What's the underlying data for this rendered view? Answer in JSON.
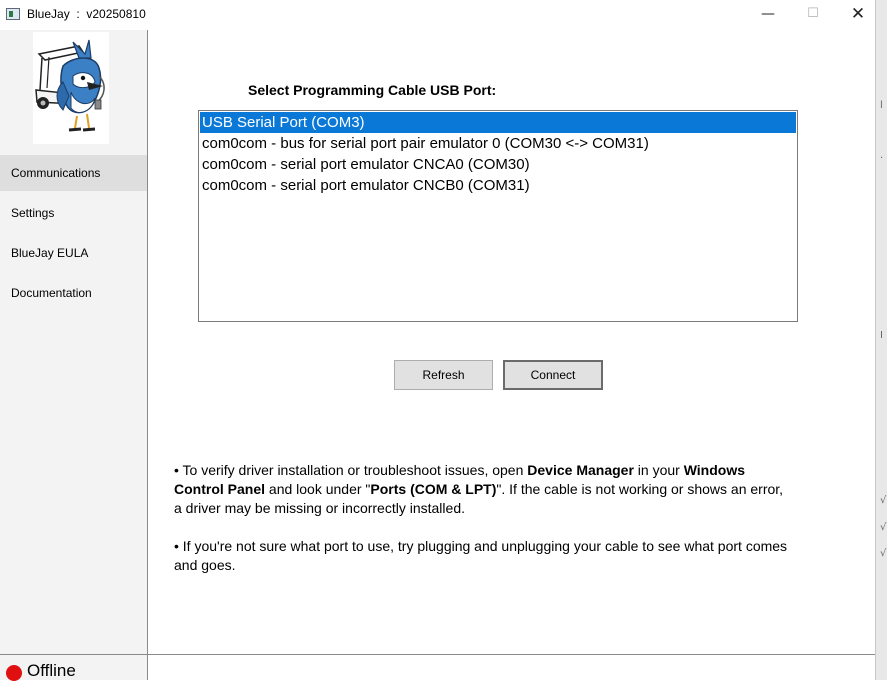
{
  "window": {
    "title": "BlueJay  :  v20250810",
    "minimize_glyph": "—",
    "maximize_glyph": "☐",
    "close_glyph": "✕",
    "app_icon": "app-window-icon"
  },
  "sidebar": {
    "logo": "bluejay-golf-cart-mascot",
    "items": [
      {
        "label": "Communications",
        "active": true
      },
      {
        "label": "Settings",
        "active": false
      },
      {
        "label": "BlueJay EULA",
        "active": false
      },
      {
        "label": "Documentation",
        "active": false
      }
    ],
    "status": {
      "label": "Offline",
      "color": "#e01010"
    }
  },
  "main": {
    "heading": "Select Programming Cable USB Port:",
    "ports": [
      {
        "label": "USB Serial Port (COM3)",
        "selected": true
      },
      {
        "label": "com0com - bus for serial port pair emulator 0 (COM30 <-> COM31)",
        "selected": false
      },
      {
        "label": "com0com - serial port emulator CNCA0 (COM30)",
        "selected": false
      },
      {
        "label": "com0com - serial port emulator CNCB0 (COM31)",
        "selected": false
      }
    ],
    "buttons": {
      "refresh": "Refresh",
      "connect": "Connect"
    },
    "info1": {
      "t1": "• To verify driver installation or troubleshoot issues, open ",
      "b1": "Device Manager",
      "t2": " in your ",
      "b2": "Windows Control Panel",
      "t3": " and look under \"",
      "b3": "Ports (COM & LPT)",
      "t4": "\". If the cable is not working or shows an error, a driver may be missing or incorrectly installed."
    },
    "info2": "• If you're not sure what port to use, try plugging and unplugging your cable to see what port comes and goes."
  },
  "colors": {
    "selection": "#0a78d7",
    "sidebar_bg": "#f3f3f3",
    "active_nav": "#dedede",
    "offline": "#e01010"
  }
}
